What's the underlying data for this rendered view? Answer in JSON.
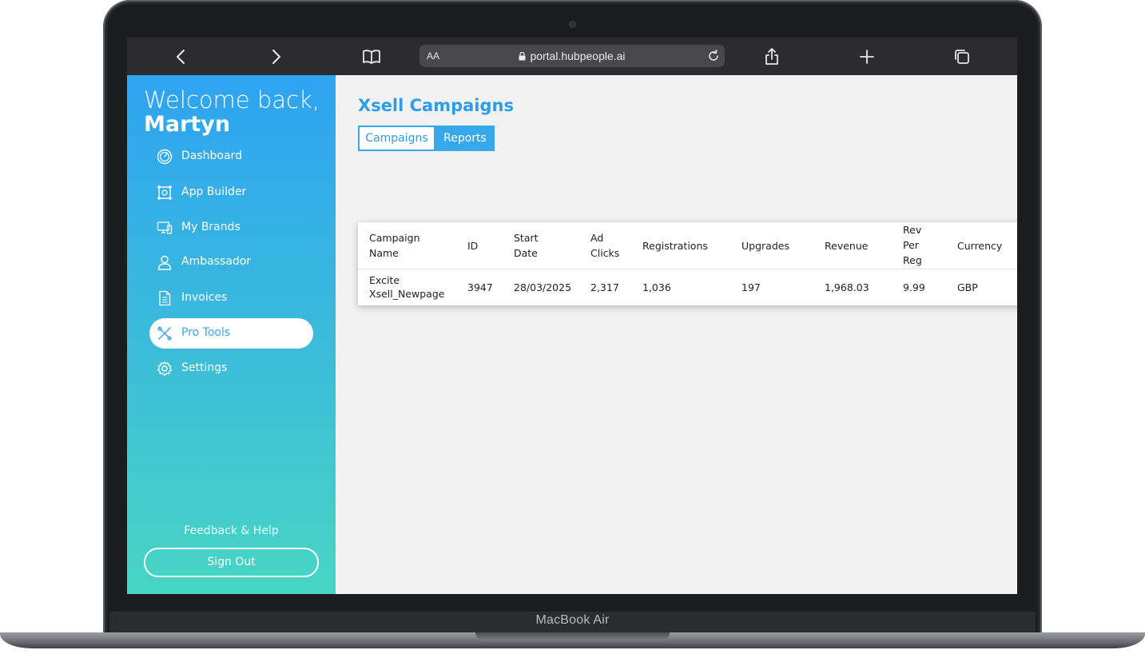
{
  "device": {
    "model": "MacBook Air"
  },
  "browser": {
    "url": "portal.hubpeople.ai",
    "text_size_label": "AA"
  },
  "sidebar": {
    "welcome": "Welcome back,",
    "user_name": "Martyn",
    "items": [
      {
        "label": "Dashboard",
        "icon": "dashboard-icon"
      },
      {
        "label": "App Builder",
        "icon": "app-builder-icon"
      },
      {
        "label": "My Brands",
        "icon": "brands-icon"
      },
      {
        "label": "Ambassador",
        "icon": "user-icon"
      },
      {
        "label": "Invoices",
        "icon": "document-icon"
      },
      {
        "label": "Pro Tools",
        "icon": "tools-icon",
        "active": true
      },
      {
        "label": "Settings",
        "icon": "gear-icon"
      }
    ],
    "feedback": "Feedback & Help",
    "sign_out": "Sign Out"
  },
  "main": {
    "title": "Xsell Campaigns",
    "tabs": [
      {
        "label": "Campaigns",
        "active": true
      },
      {
        "label": "Reports"
      }
    ],
    "table": {
      "headers": [
        [
          "Campaign",
          "Name"
        ],
        [
          "ID"
        ],
        [
          "Start",
          "Date"
        ],
        [
          "Ad",
          "Clicks"
        ],
        [
          "Registrations"
        ],
        [
          "Upgrades"
        ],
        [
          "Revenue"
        ],
        [
          "Rev",
          "Per",
          "Reg"
        ],
        [
          "Currency"
        ]
      ],
      "rows": [
        {
          "campaign_name": [
            "Excite",
            "Xsell_Newpage"
          ],
          "id": "3947",
          "start_date": "28/03/2025",
          "ad_clicks": "2,317",
          "registrations": "1,036",
          "upgrades": "197",
          "revenue": "1,968.03",
          "rev_per_reg": "9.99",
          "currency": "GBP"
        }
      ]
    }
  },
  "colors": {
    "accent": "#2d9ee8",
    "sidebar_top": "#2ea3f2",
    "sidebar_bottom": "#47d6c4"
  }
}
